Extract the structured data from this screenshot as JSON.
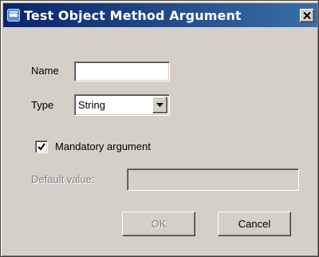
{
  "dialog": {
    "title": "Test Object Method Argument",
    "title_icon": "app-window-icon",
    "close_icon": "close-icon"
  },
  "form": {
    "name_label": "Name",
    "name_value": "",
    "type_label": "Type",
    "type_value": "String",
    "mandatory_label": "Mandatory argument",
    "mandatory_checked": true,
    "default_value_label": "Default value:",
    "default_value": ""
  },
  "buttons": {
    "ok_label": "OK",
    "ok_enabled": false,
    "cancel_label": "Cancel"
  },
  "colors": {
    "titlebar_start": "#0a246a",
    "titlebar_end": "#3a6ea5",
    "dialog_face": "#d4d0c8",
    "disabled_text": "#808080"
  }
}
